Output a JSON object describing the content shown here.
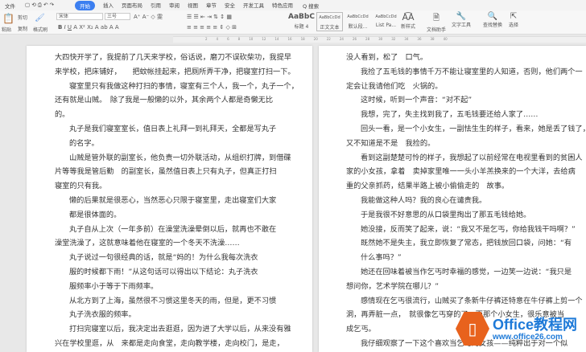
{
  "menu": {
    "file": "文件",
    "tabs": [
      "开始",
      "插入",
      "页面布局",
      "引用",
      "审阅",
      "视图",
      "章节",
      "安全",
      "开发工具",
      "特色应用"
    ],
    "search": "Q 搜索"
  },
  "ribbon": {
    "paste": "粘贴",
    "cut": "剪切",
    "copy": "复制",
    "format_painter": "格式刷",
    "font": "宋体",
    "size": "三号",
    "styles": [
      {
        "preview": "AaBbC",
        "label": "标题 4"
      },
      {
        "preview": "AaBbCcDd",
        "label": "正文文本"
      },
      {
        "preview": "AaBbCcDd",
        "label": "默认段..."
      },
      {
        "preview": "AaBbCcDd",
        "label": "List Pa..."
      }
    ],
    "new_style": "新样式",
    "doc_helper": "文档助手",
    "text_tools": "文字工具",
    "find_replace": "查找替换",
    "select": "选择"
  },
  "left_page": [
    {
      "t": "大四快开学了，我提前了几天来学校，俗话说，磨刀不误砍柴功，我提早",
      "i": 0
    },
    {
      "t": "来学校，把床铺好，　　把蚊帐挂起来，把厕所弄干净，把寝室打扫一下。",
      "i": 0
    },
    {
      "t": "寝室里只有我做这种打扫的事情，寝室有三个人，我一个，丸子一个，",
      "i": 1
    },
    {
      "t": "还有就是山贼。　除了我是一般懒的以外，其余两个人都是奇懒无比",
      "i": 0
    },
    {
      "t": "的。",
      "i": 0
    },
    {
      "t": "丸子是我们寝室室长，值日表上礼拜一到礼拜天，全都是写丸子",
      "i": 1
    },
    {
      "t": "的名字。",
      "i": 1
    },
    {
      "t": "山贼是管外联的副室长，他负责一切外联活动，从组织打牌，到借碟",
      "i": 1
    },
    {
      "t": "片等等我是管后勤　的副室长，虽然值日表上只有丸子，但真正打扫",
      "i": 0
    },
    {
      "t": "寝室的只有我。",
      "i": 0
    },
    {
      "t": "懒的后果就是很恶心，当然恶心只限于寝室里，走出寝室们大家",
      "i": 1
    },
    {
      "t": "都是很体面的。",
      "i": 1
    },
    {
      "t": "丸子自从上次（一年多前）在澡堂洗澡晕倒以后，就再也不敢在",
      "i": 1
    },
    {
      "t": "澡堂洗澡了，这就意味着他在寝室的一个冬天不洗澡……",
      "i": 0
    },
    {
      "t": "丸子说过一句很经典的话，就是“妈的！为什么我每次洗衣",
      "i": 1
    },
    {
      "t": "服的时候都下雨！”从这句话可以得出以下结论：丸子洗衣",
      "i": 1
    },
    {
      "t": "服频率小于等于下雨频率。",
      "i": 1
    },
    {
      "t": "从北方到了上海，虽然很不习惯这里冬天的雨，但是，更不习惯",
      "i": 1
    },
    {
      "t": "丸子洗衣服的频率。",
      "i": 1
    },
    {
      "t": "打扫完寝室以后，我决定出去逛逛，因为进了大学以后，从来没有雅",
      "i": 1
    },
    {
      "t": "兴在学校里逛，从　来都是走向食堂，走向教学楼，走向校门，是走，",
      "i": 0
    }
  ],
  "right_page": [
    {
      "t": "没人看到，松了　口气。",
      "i": 0
    },
    {
      "t": "我捡了五毛钱的事情千万不能让寝室里的人知道，否则，他们两个一",
      "i": 1
    },
    {
      "t": "定会让我请他们吃　火锅的。",
      "i": 0
    },
    {
      "t": "这时候，听到一个声音：“对不起”",
      "i": 1
    },
    {
      "t": "我想，完了，失主找到我了，五毛钱要还给人家了……",
      "i": 1
    },
    {
      "t": "回头一看，是一个小女生，一副怯生生的样子，看来，她是丢了钱了，",
      "i": 1
    },
    {
      "t": "又不知道是不是　我捡的。",
      "i": 0
    },
    {
      "t": "看到这副楚楚可怜的样子，我想起了以前经常在电视里看到的贫困人",
      "i": 1
    },
    {
      "t": "家的小女孩，拿着　卖掉家里唯一一头小羊羔换来的一个大洋，去给病",
      "i": 0
    },
    {
      "t": "重的父亲抓药，结果半路上被小偷偷走的　故事。",
      "i": 0
    },
    {
      "t": "我能做这种人吗？我的良心在谴责我。",
      "i": 1
    },
    {
      "t": "于是我很不好意思的从口袋里掏出了那五毛钱给她。",
      "i": 1
    },
    {
      "t": "她没接，反而笑了起来，说：“我又不是乞丐，你给我钱干吗啊？”",
      "i": 1
    },
    {
      "t": "既然她不是失主，我立即恢复了常态，把钱放回口袋，问她：“有",
      "i": 1
    },
    {
      "t": "什么事吗？”",
      "i": 1
    },
    {
      "t": "她还在回味着被当作乞丐时幸福的感觉，一边笑一边说：“我只是",
      "i": 1
    },
    {
      "t": "想问你，艺术学院在哪儿？”",
      "i": 0
    },
    {
      "t": "感情现在乞丐很流行，山贼买了条新牛仔裤还特意在牛仔裤上剪一个",
      "i": 1
    },
    {
      "t": "洞，再弄脏一点，　就很像乞丐穿的了，而那个小女生，很乐意被当",
      "i": 0
    },
    {
      "t": "成乞丐。",
      "i": 0
    },
    {
      "t": "我仔细观察了一下这个喜欢当乞丐的女孩——纯粹出于对一个似",
      "i": 1
    }
  ],
  "watermark": {
    "title": "Office教程网",
    "url": "www.office26.com",
    "accent": "#e8621d",
    "brand": "#1e7ad8"
  }
}
